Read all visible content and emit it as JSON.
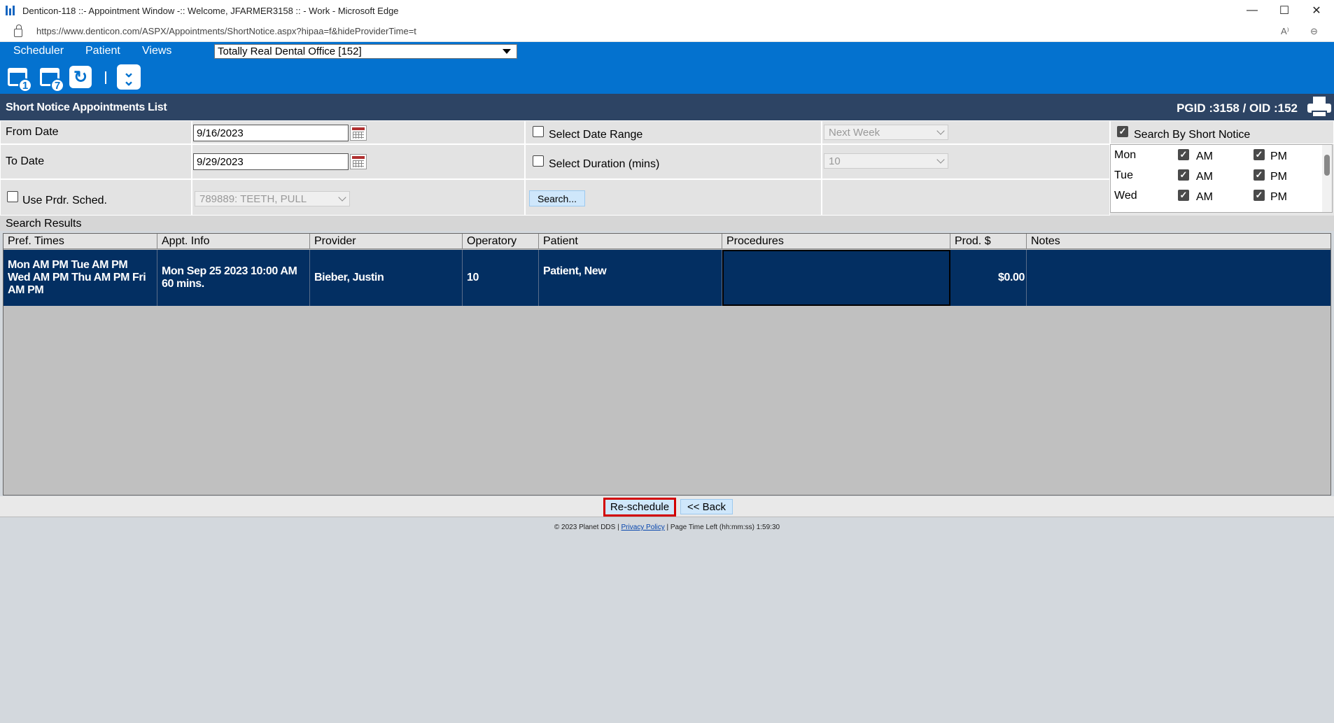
{
  "window": {
    "title": "Denticon-118 ::- Appointment Window -:: Welcome, JFARMER3158 :: - Work - Microsoft Edge",
    "minimize": "—",
    "maximize": "☐",
    "close": "✕"
  },
  "address": {
    "url": "https://www.denticon.com/ASPX/Appointments/ShortNotice.aspx?hipaa=f&hideProviderTime=t",
    "read_aloud": "A⁾",
    "zoom": "⊖"
  },
  "nav": {
    "menus": [
      "Scheduler",
      "Patient",
      "Views"
    ],
    "office": "Totally Real Dental Office [152]"
  },
  "toolbar": {
    "day_view_num": "1",
    "week_view_num": "7",
    "refresh_glyph": "↻",
    "expand_glyph": "⌄"
  },
  "header": {
    "title": "Short Notice Appointments List",
    "ids": "PGID :3158  /  OID :152"
  },
  "filters": {
    "from_date_label": "From Date",
    "from_date": "9/16/2023",
    "to_date_label": "To Date",
    "to_date": "9/29/2023",
    "use_prdr_label": "Use Prdr. Sched.",
    "prdr_value": "789889: TEETH, PULL",
    "select_date_range_label": "Select Date Range",
    "date_range_value": "Next Week",
    "select_duration_label": "Select Duration (mins)",
    "duration_value": "10",
    "search_button": "Search...",
    "search_by_short_notice_label": "Search By Short Notice",
    "days": [
      {
        "name": "Mon",
        "am": "AM",
        "pm": "PM"
      },
      {
        "name": "Tue",
        "am": "AM",
        "pm": "PM"
      },
      {
        "name": "Wed",
        "am": "AM",
        "pm": "PM"
      }
    ]
  },
  "results": {
    "label": "Search Results",
    "columns": [
      "Pref. Times",
      "Appt. Info",
      "Provider",
      "Operatory",
      "Patient",
      "Procedures",
      "Prod. $",
      "Notes"
    ],
    "rows": [
      {
        "pref_times": "Mon AM PM Tue AM PM Wed AM PM Thu AM PM Fri AM PM",
        "appt_info": "Mon Sep 25 2023 10:00 AM 60 mins.",
        "provider": "Bieber, Justin",
        "operatory": "10",
        "patient": "Patient, New",
        "procedures": "",
        "prod": "$0.00",
        "notes": ""
      }
    ]
  },
  "actions": {
    "reschedule": "Re-schedule",
    "back": "<< Back"
  },
  "footer": {
    "copyright": "© 2023 Planet DDS |",
    "privacy": "Privacy Policy",
    "time_left": "| Page Time Left (hh:mm:ss) 1:59:30"
  }
}
